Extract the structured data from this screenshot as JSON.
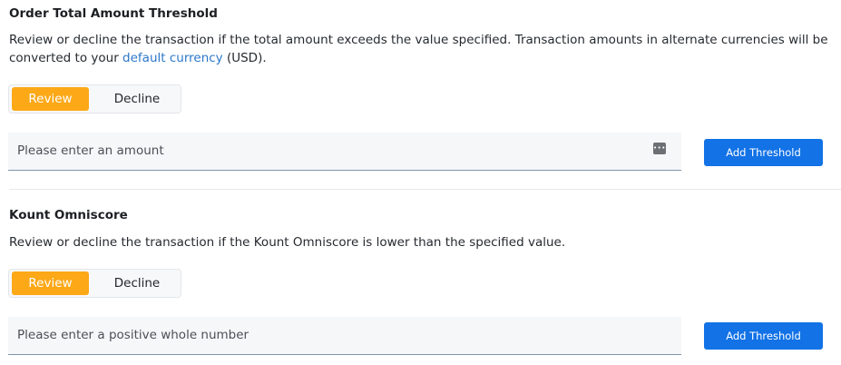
{
  "threshold_section": {
    "title": "Order Total Amount Threshold",
    "description_part1": "Review or decline the transaction if the total amount exceeds the value specified. Transaction amounts in alternate currencies will be converted to your ",
    "description_link": "default currency",
    "description_part2": " (USD).",
    "toggle": {
      "options": [
        "Review",
        "Decline"
      ],
      "selected": "Review"
    },
    "input": {
      "value": "",
      "placeholder": "Please enter an amount",
      "icon": "password-manager-icon"
    },
    "button_label": "Add Threshold"
  },
  "omniscore_section": {
    "title": "Kount Omniscore",
    "description": "Review or decline the transaction if the Kount Omniscore is lower than the specified value.",
    "toggle": {
      "options": [
        "Review",
        "Decline"
      ],
      "selected": "Review"
    },
    "input": {
      "value": "",
      "placeholder": "Please enter a positive whole number"
    },
    "button_label": "Add Threshold"
  },
  "colors": {
    "selected_toggle": "#fca817",
    "primary_button": "#1272e6",
    "link": "#2c77c9",
    "input_underline": "#7e94ab"
  }
}
